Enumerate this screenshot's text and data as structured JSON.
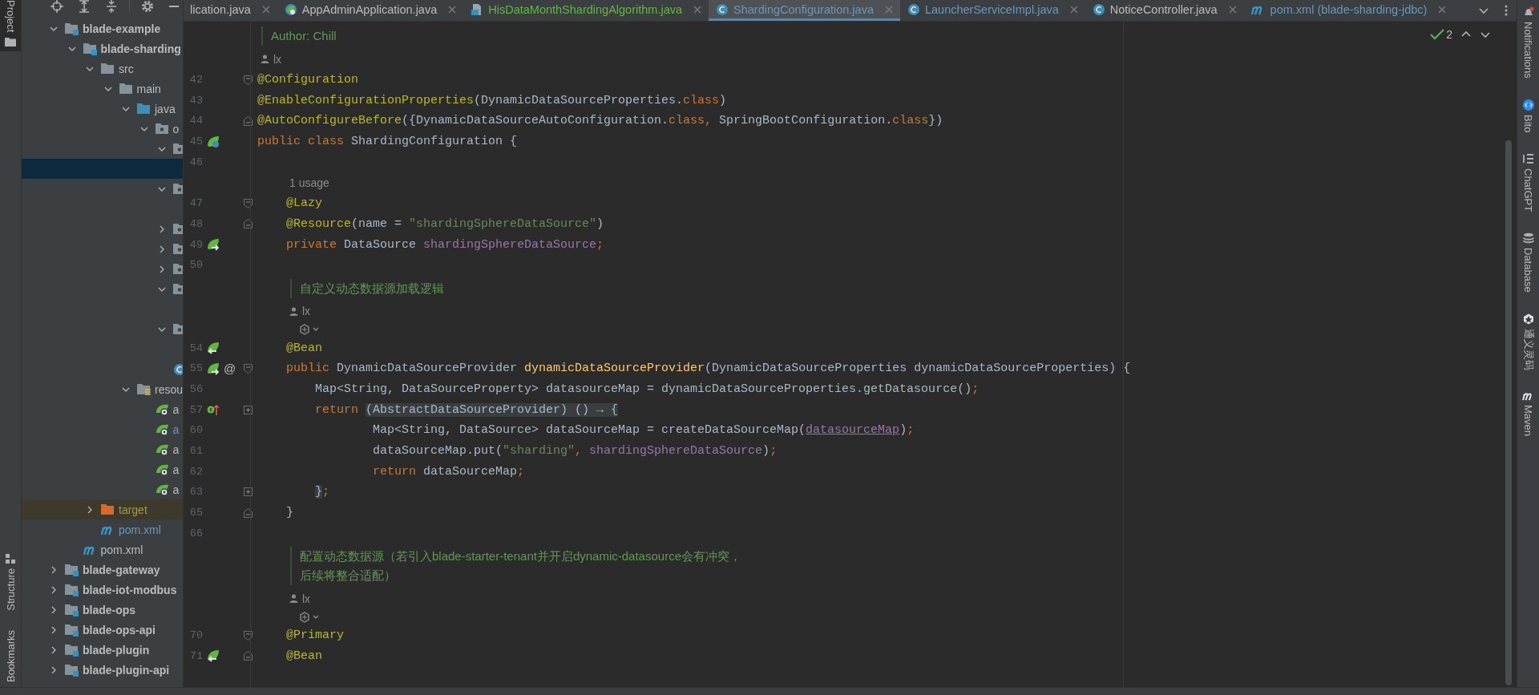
{
  "left_toolbar": {
    "top": [
      {
        "label": "Project",
        "kind": "folder",
        "selected": true
      }
    ],
    "bottom": [
      {
        "label": "Structure",
        "kind": "structure",
        "selected": false
      },
      {
        "label": "Bookmarks",
        "kind": "bookmark",
        "selected": false
      }
    ]
  },
  "project": {
    "toolbar": [
      {
        "kind": "locate"
      },
      {
        "kind": "expand"
      },
      {
        "kind": "collapse"
      },
      {
        "kind": "settings"
      },
      {
        "kind": "minimize"
      }
    ],
    "tree": [
      {
        "label": "blade-example",
        "kind": "module",
        "expanded": true,
        "selected": false,
        "children": [
          {
            "label": "blade-sharding",
            "kind": "module",
            "expanded": true,
            "selected": false,
            "children": [
              {
                "label": "src",
                "kind": "folder",
                "expanded": true,
                "selected": false,
                "children": [
                  {
                    "label": "main",
                    "kind": "folder",
                    "expanded": true,
                    "selected": false,
                    "children": [
                      {
                        "label": "java",
                        "kind": "source-root",
                        "expanded": true,
                        "selected": false,
                        "children": [
                          {
                            "label": "o",
                            "kind": "package",
                            "expanded": true,
                            "selected": false,
                            "children": [
                              {
                                "kind": "package",
                                "expanded": true,
                                "selected": false,
                                "children": [
                                  {
                                    "selected": true
                                  }
                                ]
                              },
                              {
                                "kind": "package",
                                "expanded": true,
                                "selected": false,
                                "children": [
                                  {
                                    "selected": false
                                  }
                                ]
                              },
                              {
                                "kind": "package",
                                "expanded": false,
                                "selected": false
                              },
                              {
                                "kind": "package",
                                "expanded": false,
                                "selected": false
                              },
                              {
                                "kind": "package",
                                "expanded": false,
                                "selected": false
                              },
                              {
                                "kind": "package",
                                "expanded": true,
                                "selected": false,
                                "children": [
                                  {
                                    "selected": false
                                  }
                                ]
                              },
                              {
                                "kind": "package",
                                "expanded": true,
                                "selected": false,
                                "children": [
                                  {
                                    "selected": false
                                  }
                                ]
                              },
                              {
                                "kind": "class",
                                "selected": false
                              }
                            ]
                          }
                        ]
                      },
                      {
                        "label": "resou",
                        "kind": "resources-root",
                        "expanded": true,
                        "selected": false,
                        "children": [
                          {
                            "label": "a",
                            "kind": "config",
                            "selected": false
                          },
                          {
                            "label": "a",
                            "kind": "config",
                            "selected": false,
                            "modified": true
                          },
                          {
                            "label": "a",
                            "kind": "config",
                            "selected": false
                          },
                          {
                            "label": "a",
                            "kind": "config",
                            "selected": false
                          },
                          {
                            "label": "a",
                            "kind": "config",
                            "selected": false
                          }
                        ]
                      }
                    ]
                  }
                ]
              },
              {
                "label": "target",
                "kind": "excluded-folder",
                "expanded": false,
                "selected": false,
                "ignored": true
              },
              {
                "label": "pom.xml",
                "kind": "maven",
                "selected": false,
                "modified": true
              }
            ]
          },
          {
            "label": "pom.xml",
            "kind": "maven",
            "selected": false
          }
        ]
      },
      {
        "label": "blade-gateway",
        "kind": "module",
        "expanded": false,
        "selected": false
      },
      {
        "label": "blade-iot-modbus",
        "kind": "module",
        "expanded": false,
        "selected": false
      },
      {
        "label": "blade-ops",
        "kind": "module",
        "expanded": false,
        "selected": false
      },
      {
        "label": "blade-ops-api",
        "kind": "module",
        "expanded": false,
        "selected": false
      },
      {
        "label": "blade-plugin",
        "kind": "module",
        "expanded": false,
        "selected": false
      },
      {
        "label": "blade-plugin-api",
        "kind": "module",
        "expanded": false,
        "selected": false
      }
    ]
  },
  "tabs": [
    {
      "label": "lication.java",
      "color": "#bbbbbb",
      "selected": false
    },
    {
      "label": "AppAdminApplication.java",
      "kind": "spring",
      "color": "#bbbbbb",
      "selected": false
    },
    {
      "label": "HisDataMonthShardingAlgorithm.java",
      "kind": "java-file",
      "color": "#62b543",
      "selected": false
    },
    {
      "label": "ShardingConfiguration.java",
      "kind": "class",
      "color": "#6897bb",
      "selected": true
    },
    {
      "label": "LauncherServiceImpl.java",
      "kind": "class",
      "color": "#6897bb",
      "selected": false
    },
    {
      "label": "NoticeController.java",
      "kind": "class",
      "color": "#bbbbbb",
      "selected": false
    },
    {
      "label": "pom.xml (blade-sharding-jdbc)",
      "kind": "maven",
      "color": "#6897bb",
      "selected": false
    }
  ],
  "editor": {
    "inspection": {
      "count": "2"
    },
    "lines": [
      {
        "kind": "doc",
        "lines": [
          "Author: Chill"
        ]
      },
      {
        "kind": "author",
        "text": "lx"
      },
      {
        "kind": "code",
        "number": "42",
        "fold": {
          "kind": "start"
        },
        "tokens": [
          {
            "kind": "annotation",
            "text": "@Configuration"
          }
        ]
      },
      {
        "kind": "code",
        "number": "43",
        "tokens": [
          {
            "kind": "annotation",
            "text": "@EnableConfigurationProperties"
          },
          {
            "kind": "plain",
            "text": "(DynamicDataSourceProperties."
          },
          {
            "kind": "keyword",
            "text": "class"
          },
          {
            "kind": "plain",
            "text": ")"
          }
        ]
      },
      {
        "kind": "code",
        "number": "44",
        "fold": {
          "kind": "end"
        },
        "tokens": [
          {
            "kind": "annotation",
            "text": "@AutoConfigureBefore"
          },
          {
            "kind": "plain",
            "text": "({DynamicDataSourceAutoConfiguration."
          },
          {
            "kind": "keyword",
            "text": "class, "
          },
          {
            "kind": "plain",
            "text": "SpringBootConfiguration."
          },
          {
            "kind": "keyword",
            "text": "class"
          },
          {
            "kind": "plain",
            "text": "})"
          }
        ]
      },
      {
        "kind": "code",
        "number": "45",
        "marker": {
          "kind": "bean-class"
        },
        "tokens": [
          {
            "kind": "keyword",
            "text": "public class "
          },
          {
            "kind": "plain",
            "text": "ShardingConfiguration {"
          }
        ]
      },
      {
        "kind": "code",
        "number": "46"
      },
      {
        "kind": "usages",
        "text": "1 usage"
      },
      {
        "kind": "code",
        "number": "47",
        "fold": {
          "kind": "start"
        },
        "tokens": [
          {
            "kind": "annotation",
            "text": "    @Lazy"
          }
        ]
      },
      {
        "kind": "code",
        "number": "48",
        "fold": {
          "kind": "end"
        },
        "tokens": [
          {
            "kind": "annotation",
            "text": "    @Resource"
          },
          {
            "kind": "plain",
            "text": "(name = "
          },
          {
            "kind": "string",
            "text": "\"shardingSphereDataSource\""
          },
          {
            "kind": "plain",
            "text": ")"
          }
        ]
      },
      {
        "kind": "code",
        "number": "49",
        "marker": {
          "kind": "bean-inject"
        },
        "tokens": [
          {
            "kind": "keyword",
            "text": "    private "
          },
          {
            "kind": "plain",
            "text": "DataSource "
          },
          {
            "kind": "field",
            "text": "shardingSphereDataSource"
          },
          {
            "kind": "keyword",
            "text": ";"
          }
        ]
      },
      {
        "kind": "code",
        "number": "50"
      },
      {
        "kind": "doc",
        "lines": [
          "自定义动态数据源加载逻辑"
        ]
      },
      {
        "kind": "author",
        "text": "lx"
      },
      {
        "kind": "ai-action"
      },
      {
        "kind": "code",
        "number": "54",
        "marker": {
          "kind": "bean-provide"
        },
        "tokens": [
          {
            "kind": "annotation",
            "text": "    @Bean"
          }
        ]
      },
      {
        "kind": "code",
        "number": "55",
        "marker": {
          "kind": "bean-inject"
        },
        "gutter_text": "@",
        "fold": {
          "kind": "start"
        },
        "tokens": [
          {
            "kind": "keyword",
            "text": "    public "
          },
          {
            "kind": "plain",
            "text": "DynamicDataSourceProvider "
          },
          {
            "kind": "method",
            "text": "dynamicDataSourceProvider"
          },
          {
            "kind": "plain",
            "text": "(DynamicDataSourceProperties dynamicDataSourceProperties) {"
          }
        ]
      },
      {
        "kind": "code",
        "number": "56",
        "tokens": [
          {
            "kind": "plain",
            "text": "        Map<String, DataSourceProperty> datasourceMap = dynamicDataSourceProperties.getDatasource()"
          },
          {
            "kind": "keyword",
            "text": ";"
          }
        ]
      },
      {
        "kind": "code",
        "number": "57",
        "marker": {
          "kind": "implement"
        },
        "fold": {
          "kind": "collapsed"
        },
        "tokens": [
          {
            "kind": "keyword",
            "text": "        return "
          },
          {
            "kind": "folded",
            "text": "(AbstractDataSourceProvider) () → {"
          }
        ]
      },
      {
        "kind": "code",
        "number": "60",
        "tokens": [
          {
            "kind": "plain",
            "text": "                Map<String, DataSource> dataSourceMap = createDataSourceMap("
          },
          {
            "kind": "link",
            "text": "datasourceMap"
          },
          {
            "kind": "plain",
            "text": ")"
          },
          {
            "kind": "keyword",
            "text": ";"
          }
        ]
      },
      {
        "kind": "code",
        "number": "61",
        "tokens": [
          {
            "kind": "plain",
            "text": "                dataSourceMap.put("
          },
          {
            "kind": "string",
            "text": "\"sharding\""
          },
          {
            "kind": "keyword",
            "text": ", "
          },
          {
            "kind": "field",
            "text": "shardingSphereDataSource"
          },
          {
            "kind": "plain",
            "text": ")"
          },
          {
            "kind": "keyword",
            "text": ";"
          }
        ]
      },
      {
        "kind": "code",
        "number": "62",
        "tokens": [
          {
            "kind": "keyword",
            "text": "                return "
          },
          {
            "kind": "plain",
            "text": "dataSourceMap"
          },
          {
            "kind": "keyword",
            "text": ";"
          }
        ]
      },
      {
        "kind": "code",
        "number": "63",
        "fold": {
          "kind": "collapsed"
        },
        "tokens": [
          {
            "kind": "folded",
            "text": "        }"
          },
          {
            "kind": "keyword",
            "text": ";"
          }
        ]
      },
      {
        "kind": "code",
        "number": "65",
        "fold": {
          "kind": "end"
        },
        "tokens": [
          {
            "kind": "plain",
            "text": "    }"
          }
        ]
      },
      {
        "kind": "code",
        "number": "66"
      },
      {
        "kind": "doc",
        "lines": [
          "配置动态数据源（若引入blade-starter-tenant并开启dynamic-datasource会有冲突，",
          "后续将整合适配）"
        ]
      },
      {
        "kind": "author",
        "text": "lx"
      },
      {
        "kind": "ai-action"
      },
      {
        "kind": "code",
        "number": "70",
        "fold": {
          "kind": "start"
        },
        "tokens": [
          {
            "kind": "annotation",
            "text": "    @Primary"
          }
        ]
      },
      {
        "kind": "code",
        "number": "71",
        "marker": {
          "kind": "bean-provide"
        },
        "fold": {
          "kind": "end"
        },
        "tokens": [
          {
            "kind": "annotation",
            "text": "    @Bean"
          }
        ]
      }
    ]
  },
  "right_toolbar": [
    {
      "label": "Notifications",
      "kind": "bell"
    },
    {
      "label": "Bito",
      "kind": "bito"
    },
    {
      "label": "ChatGPT",
      "kind": "chatgpt"
    },
    {
      "label": "Database",
      "kind": "database"
    },
    {
      "label": "通义灵码",
      "kind": "tongyi"
    },
    {
      "label": "Maven",
      "kind": "maven"
    }
  ]
}
